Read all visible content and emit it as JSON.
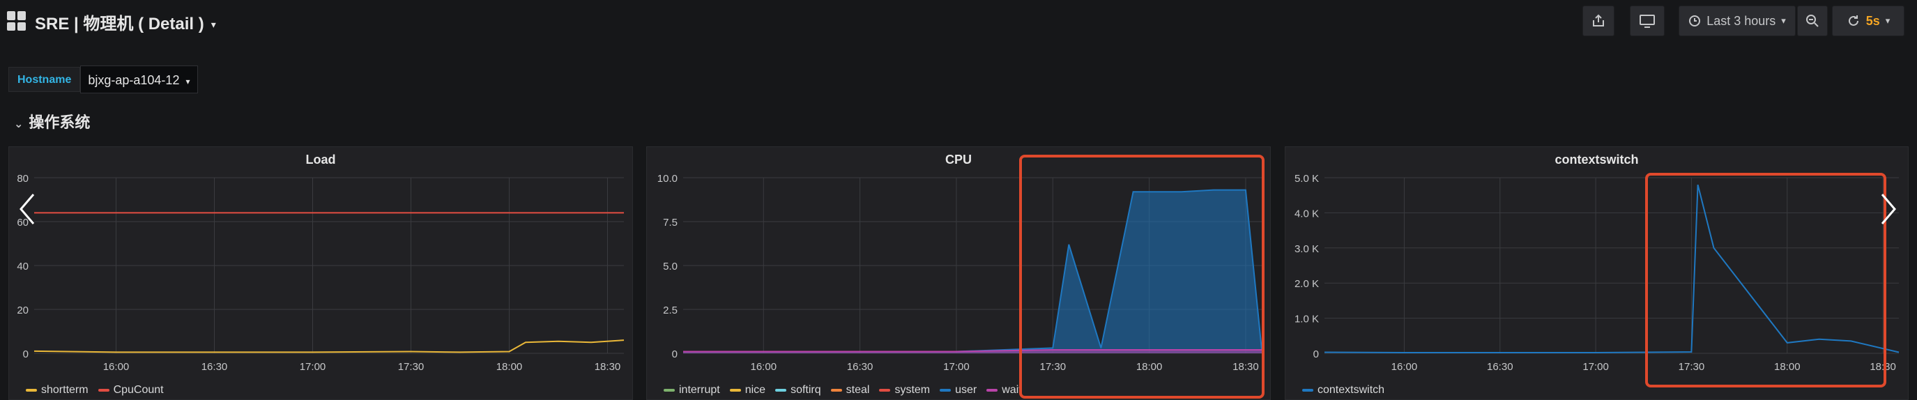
{
  "header": {
    "title": "SRE | 物理机 ( Detail )",
    "time_range": "Last 3 hours",
    "refresh_interval": "5s"
  },
  "variables": {
    "hostname_label": "Hostname",
    "hostname_value": "bjxg-ap-a104-12"
  },
  "row": {
    "title": "操作系统"
  },
  "colors": {
    "shortterm": "#eab839",
    "cpucount": "#e24d42",
    "interrupt": "#7eb26d",
    "nice": "#eab839",
    "softirq": "#6ed0e0",
    "steal": "#ef843c",
    "system": "#e24d42",
    "user": "#1f78c1",
    "wait": "#ba43a9",
    "contextswitch": "#1f78c1",
    "highlight": "#e0492c",
    "refresh": "#f5a623"
  },
  "panels": [
    {
      "title": "Load",
      "y_ticks": [
        "0",
        "20",
        "40",
        "60",
        "80"
      ],
      "x_ticks": [
        "16:00",
        "16:30",
        "17:00",
        "17:30",
        "18:00",
        "18:30"
      ],
      "legend": [
        "shortterm",
        "CpuCount"
      ]
    },
    {
      "title": "CPU",
      "y_ticks": [
        "0",
        "2.5",
        "5.0",
        "7.5",
        "10.0"
      ],
      "x_ticks": [
        "16:00",
        "16:30",
        "17:00",
        "17:30",
        "18:00",
        "18:30"
      ],
      "legend": [
        "interrupt",
        "nice",
        "softirq",
        "steal",
        "system",
        "user",
        "wait"
      ]
    },
    {
      "title": "contextswitch",
      "y_ticks": [
        "0",
        "1.0 K",
        "2.0 K",
        "3.0 K",
        "4.0 K",
        "5.0 K"
      ],
      "x_ticks": [
        "16:00",
        "16:30",
        "17:00",
        "17:30",
        "18:00",
        "18:30"
      ],
      "legend": [
        "contextswitch"
      ]
    }
  ],
  "chart_data": [
    {
      "type": "line",
      "title": "Load",
      "x": [
        "15:35",
        "16:00",
        "16:30",
        "17:00",
        "17:30",
        "17:45",
        "18:00",
        "18:05",
        "18:15",
        "18:25",
        "18:35"
      ],
      "series": [
        {
          "name": "shortterm",
          "values": [
            1,
            0.5,
            0.5,
            0.5,
            0.8,
            0.5,
            0.8,
            5,
            5.5,
            5,
            6
          ]
        },
        {
          "name": "CpuCount",
          "values": [
            64,
            64,
            64,
            64,
            64,
            64,
            64,
            64,
            64,
            64,
            64
          ]
        }
      ],
      "ylim": [
        0,
        80
      ]
    },
    {
      "type": "area",
      "title": "CPU",
      "x": [
        "15:35",
        "16:00",
        "16:30",
        "17:00",
        "17:30",
        "17:35",
        "17:45",
        "17:55",
        "18:10",
        "18:20",
        "18:30",
        "18:35"
      ],
      "series": [
        {
          "name": "user",
          "values": [
            0.1,
            0.1,
            0.1,
            0.1,
            0.3,
            6.2,
            0.3,
            9.2,
            9.2,
            9.3,
            9.3,
            0.2
          ]
        },
        {
          "name": "wait",
          "values": [
            0.1,
            0.1,
            0.1,
            0.1,
            0.2,
            0.2,
            0.2,
            0.2,
            0.2,
            0.2,
            0.2,
            0.2
          ]
        }
      ],
      "ylim": [
        0,
        10
      ]
    },
    {
      "type": "line",
      "title": "contextswitch",
      "x": [
        "15:35",
        "16:00",
        "16:30",
        "17:00",
        "17:30",
        "17:32",
        "17:37",
        "18:00",
        "18:10",
        "18:20",
        "18:35"
      ],
      "series": [
        {
          "name": "contextswitch",
          "values": [
            30,
            20,
            20,
            20,
            40,
            4800,
            3000,
            300,
            400,
            350,
            30
          ]
        }
      ],
      "ylim": [
        0,
        5000
      ]
    }
  ]
}
